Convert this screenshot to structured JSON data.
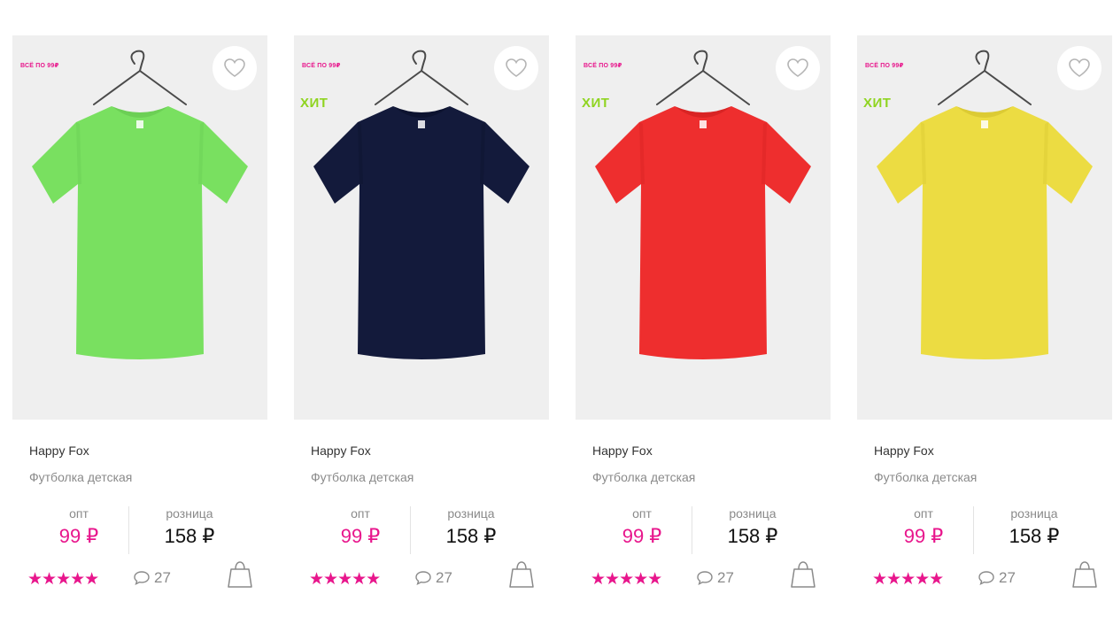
{
  "products": [
    {
      "promo": "ВСЁ ПО 99₽",
      "badge": "",
      "shirt_color": "#79e060",
      "shirt_shade": "#6ccf55",
      "brand": "Happy Fox",
      "title": "Футболка детская",
      "wholesale_label": "опт",
      "wholesale_price": "99 ₽",
      "retail_label": "розница",
      "retail_price": "158 ₽",
      "rating_stars": "★★★★★",
      "comments": "27",
      "favorite_icon": "heart-icon",
      "cart_icon": "shopping-bag-icon"
    },
    {
      "promo": "ВСЁ ПО 99₽",
      "badge": "ХИТ",
      "shirt_color": "#131a3b",
      "shirt_shade": "#0d1330",
      "brand": "Happy Fox",
      "title": "Футболка детская",
      "wholesale_label": "опт",
      "wholesale_price": "99 ₽",
      "retail_label": "розница",
      "retail_price": "158 ₽",
      "rating_stars": "★★★★★",
      "comments": "27",
      "favorite_icon": "heart-icon",
      "cart_icon": "shopping-bag-icon"
    },
    {
      "promo": "ВСЁ ПО 99₽",
      "badge": "ХИТ",
      "shirt_color": "#ee2e2e",
      "shirt_shade": "#d92424",
      "brand": "Happy Fox",
      "title": "Футболка детская",
      "wholesale_label": "опт",
      "wholesale_price": "99 ₽",
      "retail_label": "розница",
      "retail_price": "158 ₽",
      "rating_stars": "★★★★★",
      "comments": "27",
      "favorite_icon": "heart-icon",
      "cart_icon": "shopping-bag-icon"
    },
    {
      "promo": "ВСЁ ПО 99₽",
      "badge": "ХИТ",
      "shirt_color": "#ecdc42",
      "shirt_shade": "#dccb34",
      "brand": "Happy Fox",
      "title": "Футболка детская",
      "wholesale_label": "опт",
      "wholesale_price": "99 ₽",
      "retail_label": "розница",
      "retail_price": "158 ₽",
      "rating_stars": "★★★★★",
      "comments": "27",
      "favorite_icon": "heart-icon",
      "cart_icon": "shopping-bag-icon"
    }
  ],
  "colors": {
    "accent_pink": "#e8168c",
    "badge_green": "#8fd420",
    "card_bg": "#efefef"
  }
}
